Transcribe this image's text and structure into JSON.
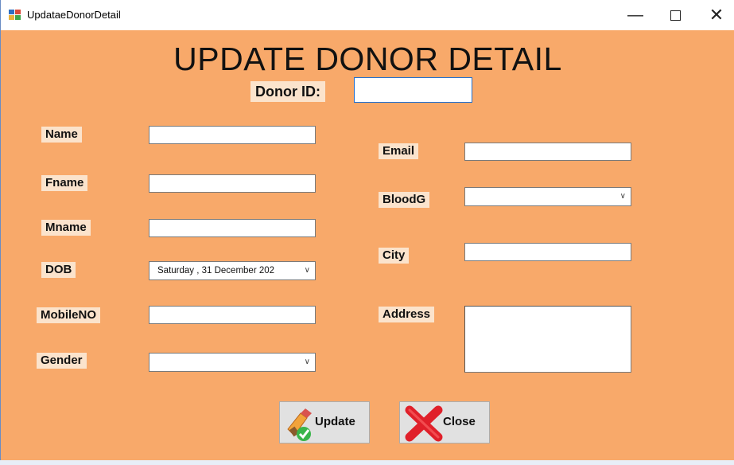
{
  "window": {
    "title": "UpdataeDonorDetail"
  },
  "titlebar": {
    "minimize": "—",
    "close": "✕"
  },
  "form": {
    "heading": "UPDATE DONOR DETAIL",
    "donor_id_label": "Donor ID:",
    "donor_id_value": "",
    "name_label": "Name",
    "fname_label": "Fname",
    "mname_label": "Mname",
    "dob_label": "DOB",
    "dob_value": "Saturday   , 31 December 202",
    "mobile_label": "MobileNO",
    "gender_label": "Gender",
    "gender_value": "",
    "email_label": "Email",
    "bloodg_label": "BloodG",
    "bloodg_value": "",
    "city_label": "City",
    "address_label": "Address"
  },
  "buttons": {
    "update": "Update",
    "close": "Close"
  },
  "icons": {
    "app": "app-icon",
    "dropdown": "chevron-down-icon",
    "update": "update-icon",
    "close": "close-x-icon"
  },
  "colors": {
    "form_bg": "#f8a96a",
    "label_bg": "#fbe3cc",
    "close_x": "#e0202a"
  }
}
